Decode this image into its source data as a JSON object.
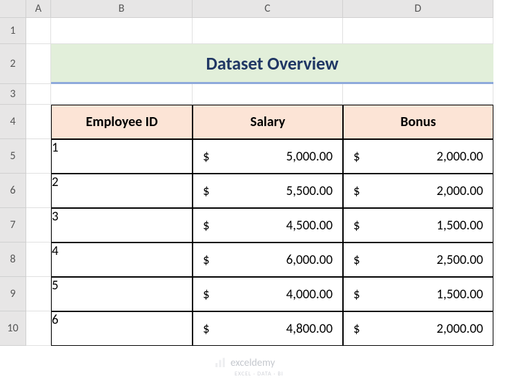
{
  "columns": [
    "A",
    "B",
    "C",
    "D"
  ],
  "rows": [
    "1",
    "2",
    "3",
    "4",
    "5",
    "6",
    "7",
    "8",
    "9",
    "10"
  ],
  "title": "Dataset Overview",
  "table": {
    "headers": [
      "Employee ID",
      "Salary",
      "Bonus"
    ],
    "data": [
      {
        "id": "1",
        "salary": "5,000.00",
        "bonus": "2,000.00"
      },
      {
        "id": "2",
        "salary": "5,500.00",
        "bonus": "2,000.00"
      },
      {
        "id": "3",
        "salary": "4,500.00",
        "bonus": "1,500.00"
      },
      {
        "id": "4",
        "salary": "6,000.00",
        "bonus": "2,500.00"
      },
      {
        "id": "5",
        "salary": "4,000.00",
        "bonus": "1,500.00"
      },
      {
        "id": "6",
        "salary": "4,800.00",
        "bonus": "2,000.00"
      }
    ]
  },
  "currency_symbol": "$",
  "watermark": {
    "main": "exceldemy",
    "sub": "EXCEL · DATA · BI"
  }
}
